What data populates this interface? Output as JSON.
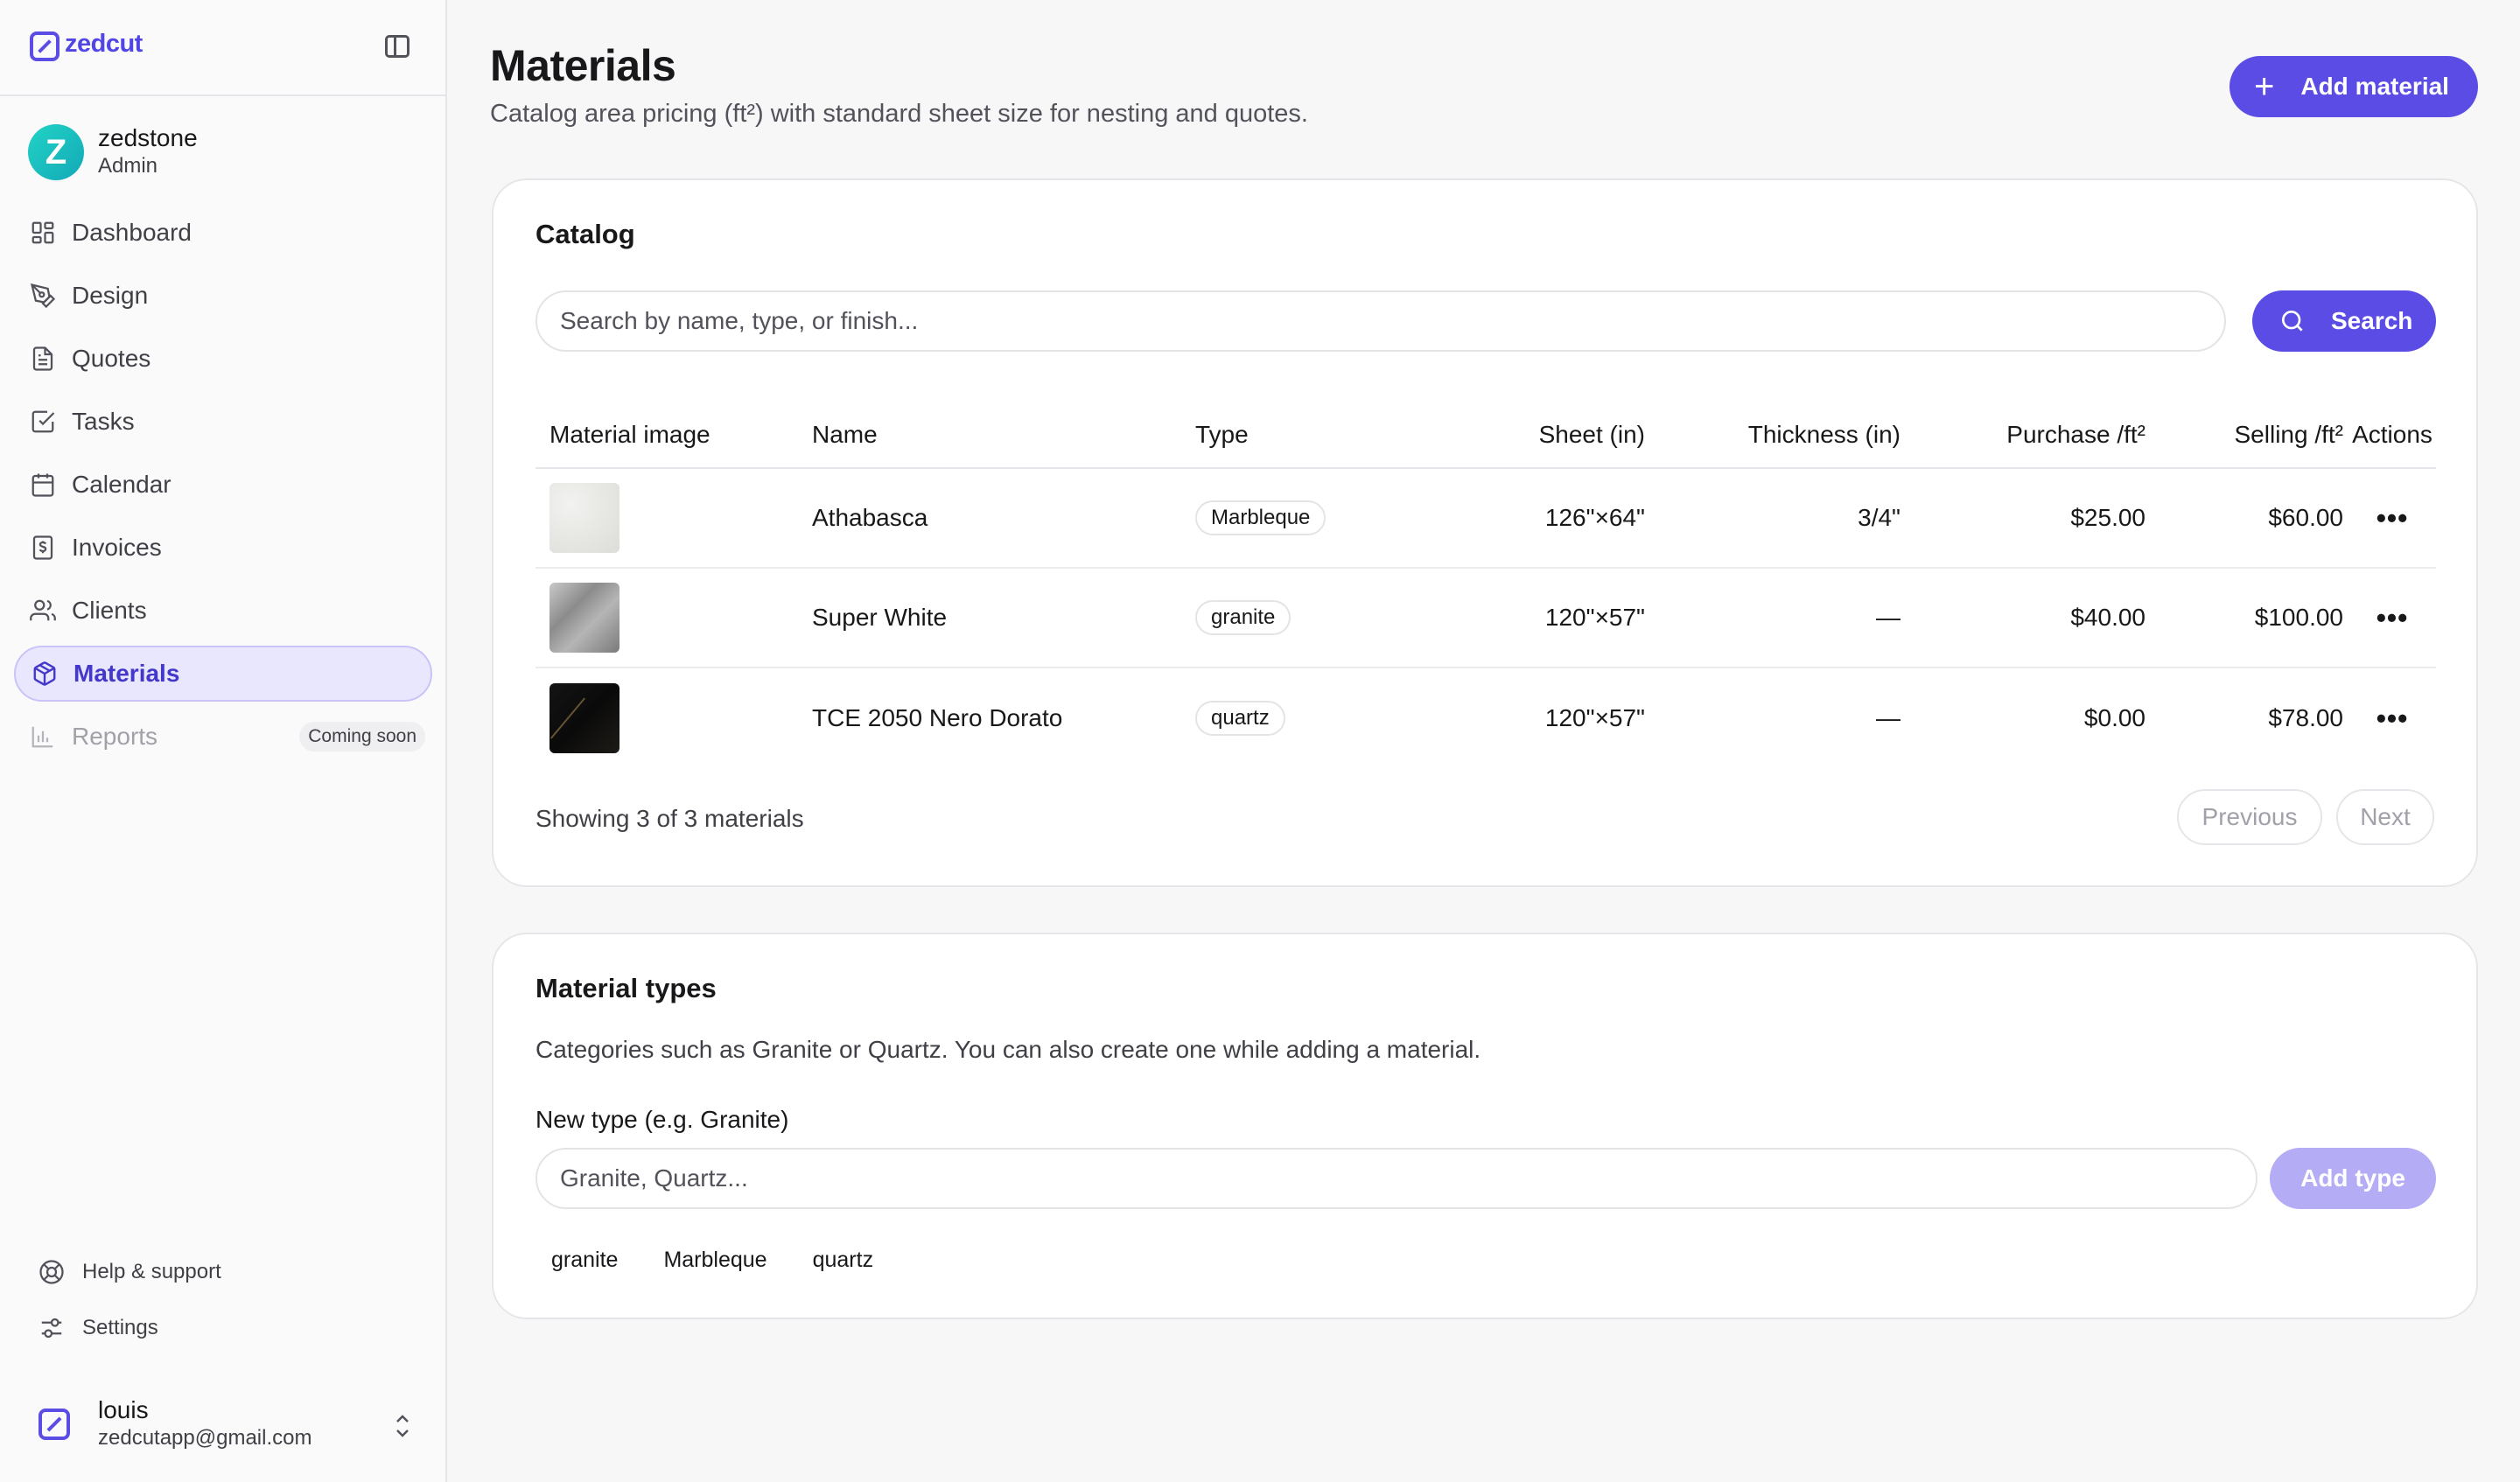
{
  "app": {
    "brand": "zedcut"
  },
  "org": {
    "initial": "Z",
    "name": "zedstone",
    "role": "Admin"
  },
  "nav": [
    {
      "key": "dashboard",
      "label": "Dashboard",
      "icon": "dashboard-icon"
    },
    {
      "key": "design",
      "label": "Design",
      "icon": "pen-tool-icon"
    },
    {
      "key": "quotes",
      "label": "Quotes",
      "icon": "document-icon"
    },
    {
      "key": "tasks",
      "label": "Tasks",
      "icon": "checkbox-icon"
    },
    {
      "key": "calendar",
      "label": "Calendar",
      "icon": "calendar-icon"
    },
    {
      "key": "invoices",
      "label": "Invoices",
      "icon": "dollar-receipt-icon"
    },
    {
      "key": "clients",
      "label": "Clients",
      "icon": "users-icon"
    },
    {
      "key": "materials",
      "label": "Materials",
      "icon": "box-icon",
      "active": true
    },
    {
      "key": "reports",
      "label": "Reports",
      "icon": "bar-chart-icon",
      "badge": "Coming soon",
      "disabled": true
    }
  ],
  "footer_links": {
    "help": "Help & support",
    "settings": "Settings"
  },
  "user": {
    "name": "louis",
    "email": "zedcutapp@gmail.com"
  },
  "page": {
    "title": "Materials",
    "subtitle": "Catalog area pricing (ft²) with standard sheet size for nesting and quotes.",
    "add_button": "Add material"
  },
  "catalog": {
    "title": "Catalog",
    "search_placeholder": "Search by name, type, or finish...",
    "search_button": "Search",
    "columns": [
      "Material image",
      "Name",
      "Type",
      "Sheet (in)",
      "Thickness (in)",
      "Purchase /ft²",
      "Selling /ft²",
      "Actions"
    ],
    "rows": [
      {
        "name": "Athabasca",
        "type": "Marbleque",
        "sheet": "126\"×64\"",
        "thickness": "3/4\"",
        "purchase": "$25.00",
        "selling": "$60.00"
      },
      {
        "name": "Super White",
        "type": "granite",
        "sheet": "120\"×57\"",
        "thickness": "—",
        "purchase": "$40.00",
        "selling": "$100.00"
      },
      {
        "name": "TCE 2050 Nero Dorato",
        "type": "quartz",
        "sheet": "120\"×57\"",
        "thickness": "—",
        "purchase": "$0.00",
        "selling": "$78.00"
      }
    ],
    "actions_glyph": "•••",
    "showing": "Showing 3 of 3 materials",
    "prev": "Previous",
    "next": "Next"
  },
  "types": {
    "title": "Material types",
    "description": "Categories such as Granite or Quartz. You can also create one while adding a material.",
    "label": "New type (e.g. Granite)",
    "placeholder": "Granite, Quartz...",
    "add_button": "Add type",
    "existing": [
      "granite",
      "Marbleque",
      "quartz"
    ]
  },
  "colors": {
    "accent": "#5b4ce6",
    "accent_disabled": "#b4acf5",
    "active_nav_bg": "#e9e7fd"
  }
}
